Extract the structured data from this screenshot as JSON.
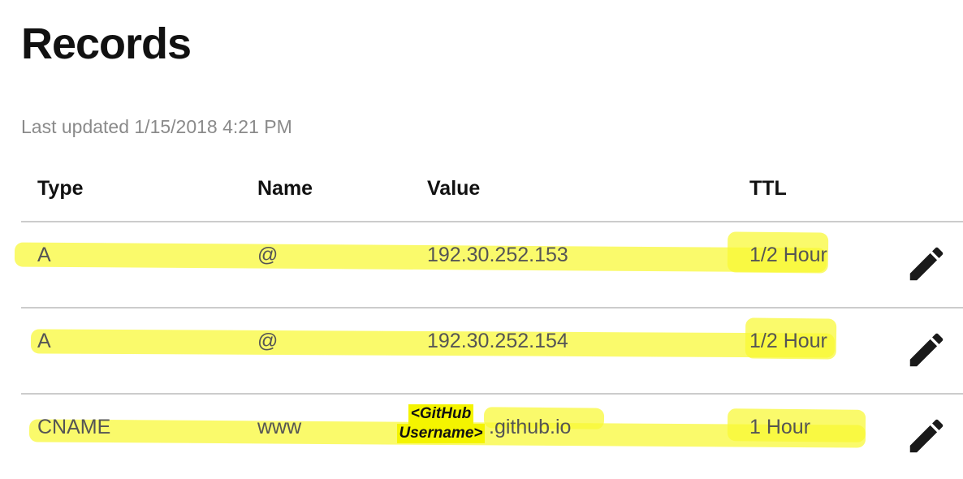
{
  "page": {
    "title": "Records",
    "last_updated": "Last updated 1/15/2018 4:21 PM"
  },
  "table": {
    "headers": {
      "type": "Type",
      "name": "Name",
      "value": "Value",
      "ttl": "TTL"
    },
    "rows": [
      {
        "type": "A",
        "name": "@",
        "value": "192.30.252.153",
        "ttl": "1/2 Hour"
      },
      {
        "type": "A",
        "name": "@",
        "value": "192.30.252.154",
        "ttl": "1/2 Hour"
      },
      {
        "type": "CNAME",
        "name": "www",
        "value_placeholder_line1": "<GitHub",
        "value_placeholder_line2": "Username>",
        "value_suffix": ".github.io",
        "ttl": "1 Hour"
      }
    ]
  },
  "icons": {
    "edit": "pencil-icon"
  },
  "colors": {
    "highlight": "#f8f832",
    "placeholder_highlight": "#f4f400",
    "text_muted": "#8a8a8a",
    "divider": "#cccccc"
  }
}
